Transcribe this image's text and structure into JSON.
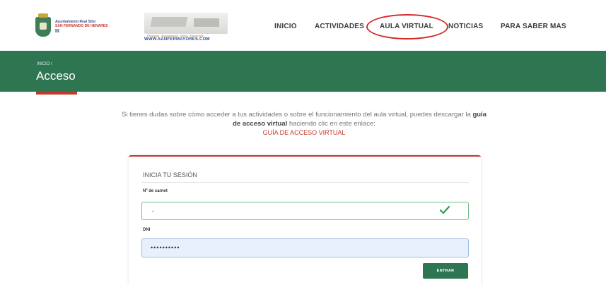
{
  "header": {
    "ayuntamiento_logo": {
      "line1": "Ayuntamiento Real Sitio",
      "line2": "SAN FERNANDO DE HENARES",
      "line3": "III"
    },
    "sanfer_logo": {
      "tagline": "Personas · Asociaciones · Entes · Provincias",
      "url": "WWW.SANFERMAYORES.COM"
    },
    "nav": [
      {
        "label": "INICIO"
      },
      {
        "label": "ACTIVIDADES"
      },
      {
        "label": "AULA VIRTUAL"
      },
      {
        "label": "NOTICIAS"
      },
      {
        "label": "PARA SABER MAS"
      }
    ],
    "highlight_color": "#d42a2a"
  },
  "banner": {
    "breadcrumb": "INICIO /",
    "title": "Acceso",
    "color": "#2e7552"
  },
  "info": {
    "text_before": "Si tienes dudas sobre cómo acceder a tus actividades o sobre el funcionamiento del aula virtual, puedes descargar la ",
    "bold_text": "guía de acceso virtual",
    "text_after": " haciendo clic en este enlace:",
    "link_label": "GUÍA DE ACCESO VIRTUAL"
  },
  "login": {
    "title": "INICIA TU SESIÓN",
    "carnet_label": "Nº de carnet",
    "carnet_value": "-",
    "dni_label": "DNI",
    "dni_value": "••••••••••",
    "submit_label": "ENTRAR"
  },
  "icons": {
    "valid": "check-icon"
  }
}
